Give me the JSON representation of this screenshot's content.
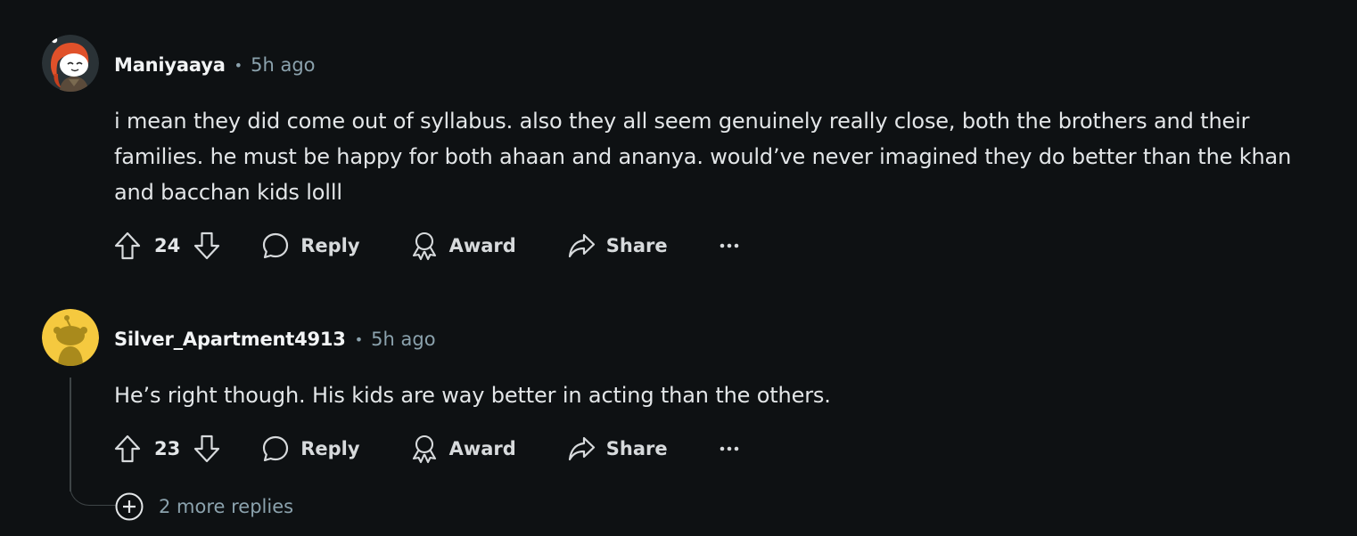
{
  "comments": [
    {
      "username": "Maniyaaya",
      "separator": "•",
      "time": "5h ago",
      "body": "i mean they did come out of syllabus. also they all seem genuinely really close, both the brothers and their families. he must be happy for both ahaan and ananya. would’ve never imagined they do better than the khan and bacchan kids lolll",
      "score": "24",
      "reply_label": "Reply",
      "award_label": "Award",
      "share_label": "Share",
      "avatar_icon": "snoo-avatar-redhead",
      "upvote_icon": "upvote-arrow-icon",
      "downvote_icon": "downvote-arrow-icon"
    },
    {
      "username": "Silver_Apartment4913",
      "separator": "•",
      "time": "5h ago",
      "body": "He’s right though. His kids are way better in acting than the others.",
      "score": "23",
      "reply_label": "Reply",
      "award_label": "Award",
      "share_label": "Share",
      "avatar_icon": "snoo-avatar-default-yellow",
      "upvote_icon": "upvote-arrow-icon",
      "downvote_icon": "downvote-arrow-icon"
    }
  ],
  "more_replies": {
    "label": "2 more replies",
    "icon": "plus-circle-icon"
  },
  "colors": {
    "background": "#0e1113",
    "text_primary": "#e3e6e8",
    "text_meta": "#8ba2ad",
    "avatar_yellow": "#f5c93f",
    "thread_line": "#3e4446"
  }
}
